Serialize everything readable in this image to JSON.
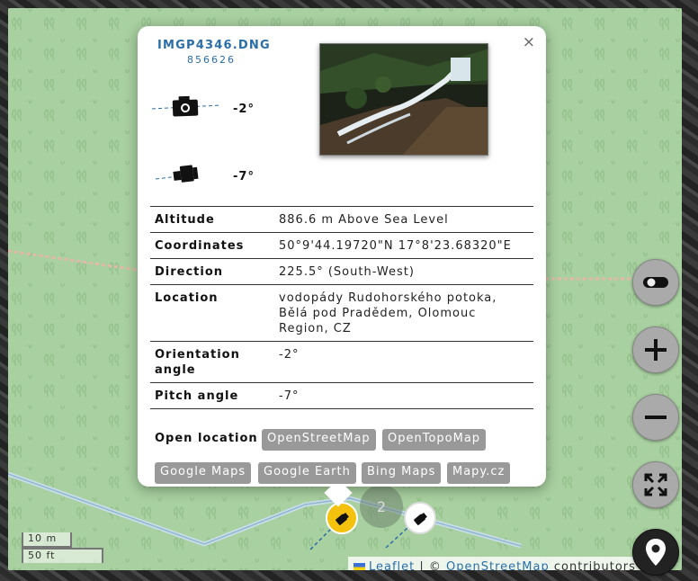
{
  "popup": {
    "filename": "IMGP4346.DNG",
    "filesize": "856626",
    "close_label": "×",
    "orientation_display": "-2°",
    "pitch_display": "-7°",
    "rows": [
      {
        "key": "Altitude",
        "value": "886.6 m Above Sea Level"
      },
      {
        "key": "Coordinates",
        "value": "50°9'44.19720\"N 17°8'23.68320\"E"
      },
      {
        "key": "Direction",
        "value": "225.5° (South-West)"
      },
      {
        "key": "Location",
        "value": "vodopády Rudohorského potoka, Bělá pod Pradědem, Olomouc Region, CZ"
      },
      {
        "key": "Orientation angle",
        "value": "-2°"
      },
      {
        "key": "Pitch angle",
        "value": "-7°"
      }
    ],
    "open_location_label": "Open location",
    "links": [
      "OpenStreetMap",
      "OpenTopoMap",
      "Google Maps",
      "Google Earth",
      "Bing Maps",
      "Mapy.cz"
    ]
  },
  "map": {
    "cluster_count": "2",
    "scale_metric": "10 m",
    "scale_imperial": "50 ft",
    "attribution": {
      "leaflet": "Leaflet",
      "separator": " | © ",
      "osm": "OpenStreetMap",
      "suffix": " contributors"
    },
    "controls": [
      "toggle-icon",
      "zoom-in-icon",
      "zoom-out-icon",
      "fullscreen-icon",
      "location-pin-icon"
    ],
    "colors": {
      "land": "#a8d0a0",
      "accent": "#2a6ea8",
      "marker_yellow": "#f4c20d",
      "button_grey": "#999999"
    }
  }
}
